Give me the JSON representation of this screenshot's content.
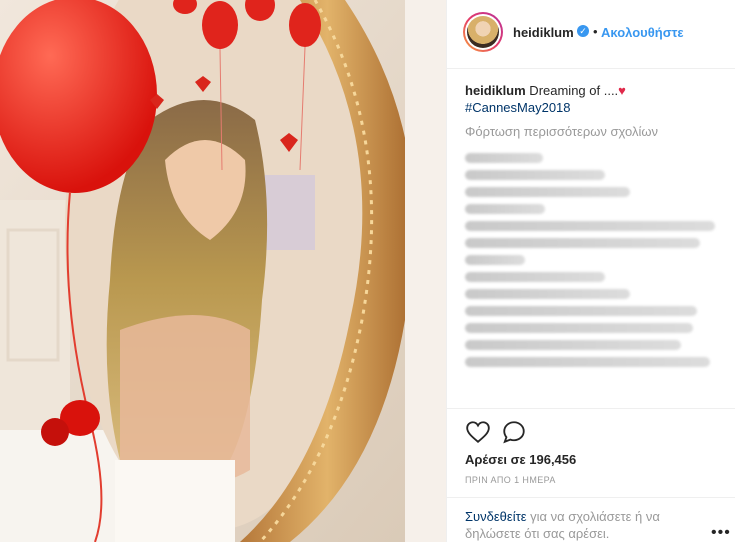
{
  "post": {
    "username": "heidiklum",
    "follow_label": "Ακολουθήστε",
    "separator": "•",
    "verified_symbol": "✓",
    "caption_user": "heidiklum",
    "caption_text": " Dreaming of ....",
    "caption_emoji": "♥",
    "hashtag": "#CannesMay2018",
    "load_more": "Φόρτωση περισσότερων σχολίων",
    "likes": "Αρέσει σε 196,456",
    "time": "ΠΡΙΝ ΑΠΟ 1 ΗΜΕΡΑ"
  },
  "footer": {
    "login_link": "Συνδεθείτε",
    "login_text": " για να σχολιάσετε ή να δηλώσετε ότι σας αρέσει.",
    "more": "•••"
  },
  "icons": {
    "like": "heart-outline-icon",
    "comment": "speech-bubble-icon",
    "verified": "verified-badge-icon",
    "more": "more-options-icon"
  },
  "colors": {
    "link": "#3897f0",
    "hashtag": "#003569",
    "muted": "#999999",
    "text": "#262626"
  }
}
